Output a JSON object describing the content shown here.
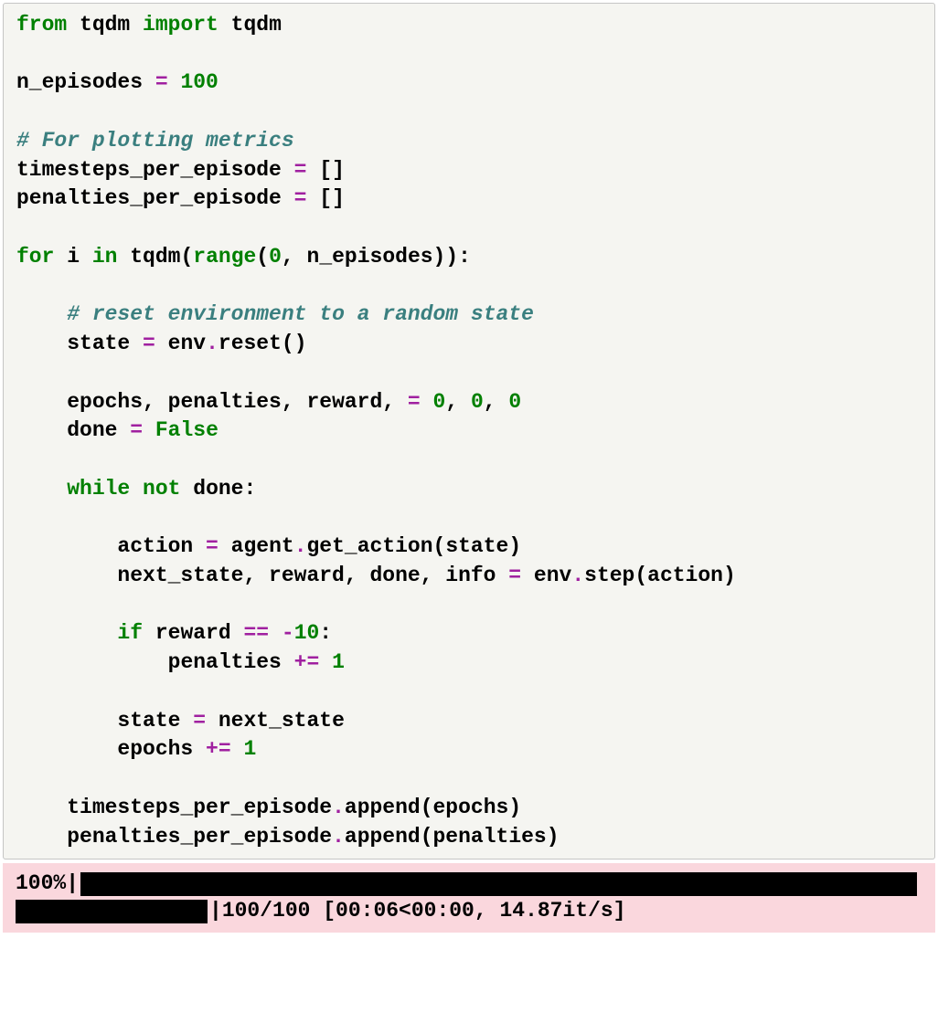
{
  "code": {
    "line1": {
      "kw1": "from",
      "mod": " tqdm ",
      "kw2": "import",
      "name": " tqdm"
    },
    "line2": "",
    "line3": {
      "var": "n_episodes ",
      "op": "=",
      "sp": " ",
      "num": "100"
    },
    "line4": "",
    "line5": {
      "cm": "# For plotting metrics"
    },
    "line6": {
      "var": "timesteps_per_episode ",
      "op": "=",
      "tail": " []"
    },
    "line7": {
      "var": "penalties_per_episode ",
      "op": "=",
      "tail": " []"
    },
    "line8": "",
    "line9": {
      "kw1": "for",
      "a": " i ",
      "kw2": "in",
      "b": " tqdm(",
      "bn": "range",
      "c": "(",
      "n1": "0",
      "d": ", n_episodes)):"
    },
    "line10": "",
    "line11": {
      "indent": "    ",
      "cm": "# reset environment to a random state"
    },
    "line12": {
      "indent": "    ",
      "a": "state ",
      "op": "=",
      "b": " env",
      "op2": ".",
      "c": "reset()"
    },
    "line13": "",
    "line14": {
      "indent": "    ",
      "a": "epochs, penalties, reward, ",
      "op": "=",
      "sp": " ",
      "n1": "0",
      "c1": ", ",
      "n2": "0",
      "c2": ", ",
      "n3": "0"
    },
    "line15": {
      "indent": "    ",
      "a": "done ",
      "op": "=",
      "sp": " ",
      "kw": "False"
    },
    "line16": "",
    "line17": {
      "indent": "    ",
      "kw1": "while",
      "sp": " ",
      "kw2": "not",
      "b": " done:"
    },
    "line18": "",
    "line19": {
      "indent": "        ",
      "a": "action ",
      "op": "=",
      "b": " agent",
      "op2": ".",
      "c": "get_action(state)"
    },
    "line20": {
      "indent": "        ",
      "a": "next_state, reward, done, info ",
      "op": "=",
      "b": " env",
      "op2": ".",
      "c": "step(action)"
    },
    "line21": "",
    "line22": {
      "indent": "        ",
      "kw": "if",
      "a": " reward ",
      "op": "==",
      "sp": " ",
      "opn": "-",
      "num": "10",
      "b": ":"
    },
    "line23": {
      "indent": "            ",
      "a": "penalties ",
      "op": "+=",
      "sp": " ",
      "num": "1"
    },
    "line24": "",
    "line25": {
      "indent": "        ",
      "a": "state ",
      "op": "=",
      "b": " next_state"
    },
    "line26": {
      "indent": "        ",
      "a": "epochs ",
      "op": "+=",
      "sp": " ",
      "num": "1"
    },
    "line27": "",
    "line28": {
      "indent": "    ",
      "a": "timesteps_per_episode",
      "op": ".",
      "b": "append(epochs)"
    },
    "line29": {
      "indent": "    ",
      "a": "penalties_per_episode",
      "op": ".",
      "b": "append(penalties)"
    }
  },
  "output": {
    "percent": "100%",
    "pipe1": "|",
    "pipe2": "|",
    "stats": " 100/100 [00:06<00:00, 14.87it/s]"
  }
}
